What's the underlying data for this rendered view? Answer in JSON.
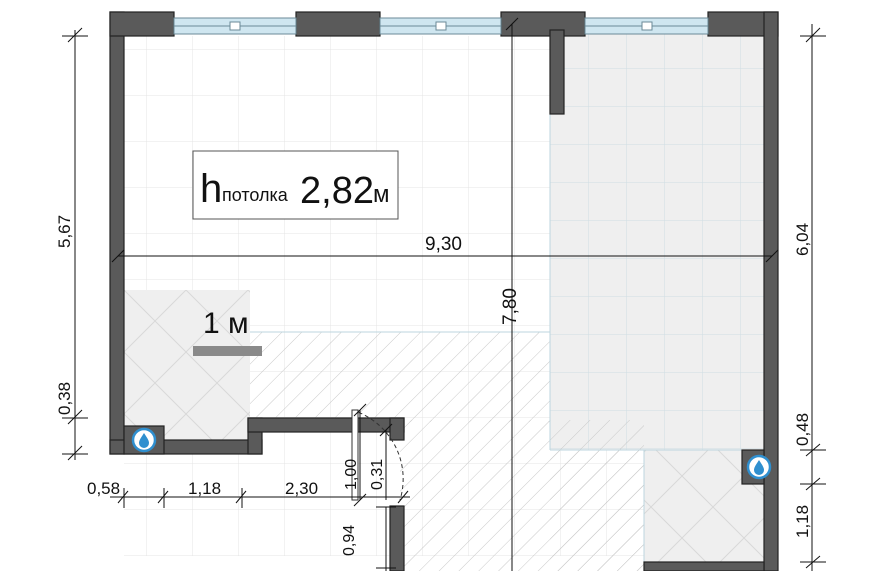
{
  "ceiling": {
    "prefix": "h",
    "word": "потолка",
    "value": "2,82",
    "unit": "м"
  },
  "scale_bar": {
    "label": "1 м"
  },
  "dimensions": {
    "total_width": "9,30",
    "total_depth": "7,80",
    "left_upper": "5,67",
    "left_lower": "0,38",
    "right_upper": "6,04",
    "right_mid": "0,48",
    "right_lower": "1,18",
    "bottom_a": "0,58",
    "bottom_b": "1,18",
    "bottom_c": "2,30",
    "door_width": "1,00",
    "door_offset": "0,31",
    "door_lower": "0,94"
  },
  "icons": {
    "riser_left": "water-drop-icon",
    "riser_right": "water-drop-icon"
  },
  "colors": {
    "wall": "#5a5a5a",
    "window": "#cfe6f0",
    "tile": "#efefef",
    "badge": "#2f8fcf"
  }
}
